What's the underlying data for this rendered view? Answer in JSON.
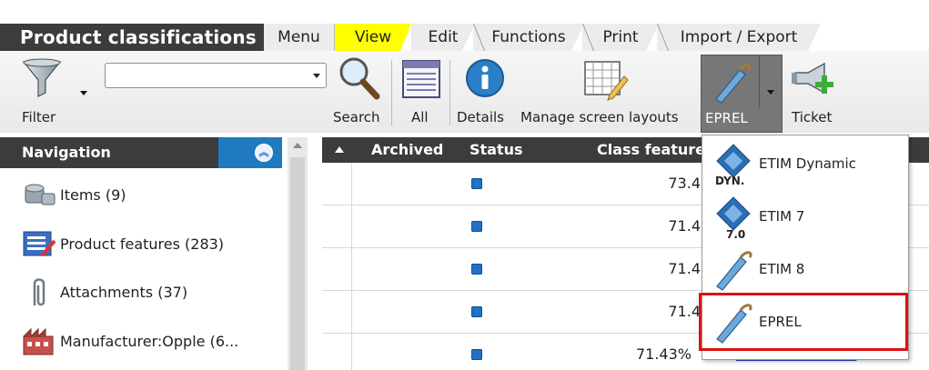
{
  "app": {
    "title": "Product classifications"
  },
  "tabs": [
    {
      "label": "Menu"
    },
    {
      "label": "View"
    },
    {
      "label": "Edit"
    },
    {
      "label": "Functions"
    },
    {
      "label": "Print"
    },
    {
      "label": "Import / Export"
    }
  ],
  "toolbar": {
    "filter_label": "Filter",
    "search_value": "",
    "search_label": "Search",
    "all_label": "All",
    "details_label": "Details",
    "layouts_label": "Manage screen layouts",
    "eprel_label": "EPREL",
    "ticket_label": "Ticket"
  },
  "navigation": {
    "title": "Navigation",
    "items": [
      {
        "label": "Items (9)",
        "icon": "items-icon"
      },
      {
        "label": "Product features (283)",
        "icon": "product-features-icon"
      },
      {
        "label": "Attachments (37)",
        "icon": "paperclip-icon"
      },
      {
        "label": "Manufacturer:Opple (6...",
        "icon": "manufacturer-icon"
      }
    ]
  },
  "grid": {
    "columns": [
      "Archived",
      "Status",
      "Class feature"
    ],
    "rows": [
      {
        "value": "73.4"
      },
      {
        "value": "71.4"
      },
      {
        "value": "71.4"
      },
      {
        "value": "71.4"
      },
      {
        "value": "71.43%",
        "link": "6958521666666"
      }
    ]
  },
  "dropdown": {
    "items": [
      {
        "label": "ETIM Dynamic",
        "icon": "etim-dynamic-icon",
        "badge": "DYN."
      },
      {
        "label": "ETIM 7",
        "icon": "etim-7-icon",
        "badge": "7.0"
      },
      {
        "label": "ETIM 8",
        "icon": "eprel-pen-icon"
      },
      {
        "label": "EPREL",
        "icon": "eprel-pen-icon",
        "highlighted": true
      }
    ]
  },
  "colors": {
    "dark_bar": "#3c3c3c",
    "view_tab": "#ffff00",
    "nav_collapse": "#1f7bbd",
    "highlight_border": "#e01010",
    "status_square": "#1e73c8",
    "link": "#1b3fbf"
  }
}
